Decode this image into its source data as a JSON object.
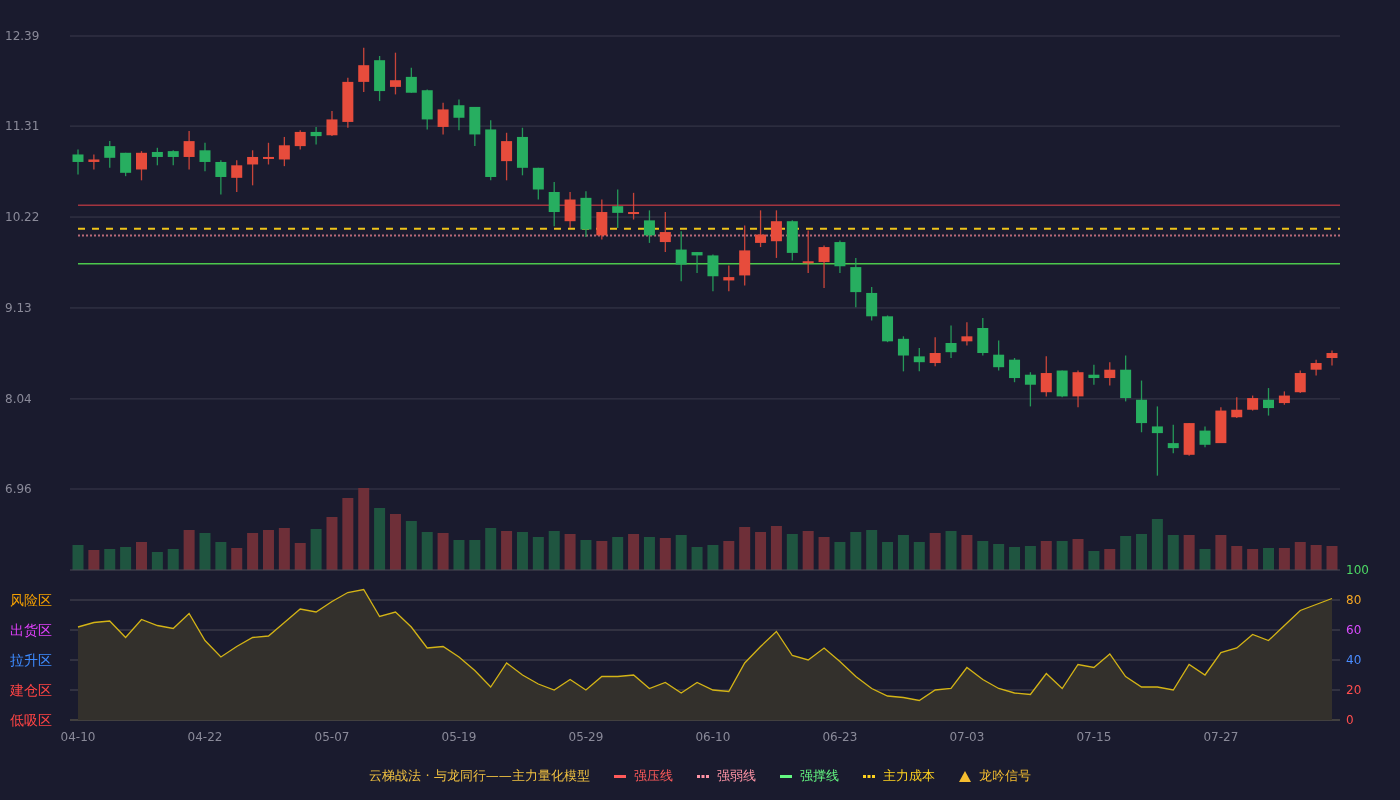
{
  "price_chart": {
    "chart_data": {
      "type": "candlestick",
      "grid": true,
      "ylim": [
        6.96,
        12.39
      ],
      "yticks": [
        12.39,
        11.31,
        10.22,
        9.13,
        8.04,
        6.96
      ],
      "categories": [
        null,
        null,
        null,
        null,
        null,
        null,
        null,
        null,
        null,
        null,
        null,
        null,
        null,
        null,
        null,
        null,
        null,
        null,
        null,
        null,
        null,
        null,
        null,
        null,
        null,
        null,
        null,
        null,
        null,
        null,
        null,
        null,
        null,
        null,
        null,
        null,
        null,
        null,
        null,
        null,
        null,
        null,
        null,
        null,
        null,
        null,
        null,
        null,
        null,
        null,
        null,
        null,
        null,
        null,
        null,
        null,
        null,
        null,
        null,
        null,
        null,
        null,
        null,
        null,
        null,
        null,
        null,
        null,
        null,
        null,
        null,
        null,
        null,
        null,
        null,
        null,
        null,
        null,
        null,
        null
      ],
      "ohlc": [
        [
          10.97,
          11.03,
          10.73,
          10.88
        ],
        [
          10.88,
          10.97,
          10.79,
          10.91
        ],
        [
          11.07,
          11.13,
          10.81,
          10.93
        ],
        [
          10.99,
          10.99,
          10.71,
          10.75
        ],
        [
          10.79,
          11.01,
          10.66,
          10.99
        ],
        [
          11.0,
          11.05,
          10.84,
          10.94
        ],
        [
          11.01,
          11.02,
          10.84,
          10.94
        ],
        [
          10.94,
          11.25,
          10.79,
          11.13
        ],
        [
          11.02,
          11.11,
          10.77,
          10.88
        ],
        [
          10.88,
          10.9,
          10.49,
          10.7
        ],
        [
          10.69,
          10.9,
          10.52,
          10.84
        ],
        [
          10.85,
          11.02,
          10.6,
          10.94
        ],
        [
          10.93,
          11.11,
          10.85,
          10.94
        ],
        [
          10.91,
          11.18,
          10.83,
          11.08
        ],
        [
          11.07,
          11.26,
          11.03,
          11.24
        ],
        [
          11.24,
          11.3,
          11.09,
          11.19
        ],
        [
          11.2,
          11.49,
          11.19,
          11.39
        ],
        [
          11.36,
          11.89,
          11.29,
          11.84
        ],
        [
          11.84,
          12.25,
          11.72,
          12.04
        ],
        [
          12.1,
          12.15,
          11.61,
          11.73
        ],
        [
          11.78,
          12.19,
          11.69,
          11.86
        ],
        [
          11.9,
          12.01,
          11.71,
          11.71
        ],
        [
          11.74,
          11.75,
          11.27,
          11.39
        ],
        [
          11.3,
          11.59,
          11.21,
          11.51
        ],
        [
          11.56,
          11.63,
          11.26,
          11.41
        ],
        [
          11.54,
          11.54,
          11.07,
          11.21
        ],
        [
          11.27,
          11.38,
          10.66,
          10.7
        ],
        [
          10.89,
          11.23,
          10.66,
          11.13
        ],
        [
          11.18,
          11.29,
          10.72,
          10.81
        ],
        [
          10.81,
          10.81,
          10.43,
          10.55
        ],
        [
          10.52,
          10.64,
          10.11,
          10.28
        ],
        [
          10.17,
          10.52,
          10.09,
          10.43
        ],
        [
          10.45,
          10.53,
          9.98,
          10.07
        ],
        [
          10.0,
          10.43,
          9.95,
          10.28
        ],
        [
          10.35,
          10.55,
          10.09,
          10.27
        ],
        [
          10.27,
          10.51,
          10.19,
          10.28
        ],
        [
          10.18,
          10.3,
          9.91,
          10.0
        ],
        [
          9.92,
          10.28,
          9.8,
          10.04
        ],
        [
          9.83,
          10.05,
          9.45,
          9.65
        ],
        [
          9.8,
          9.8,
          9.55,
          9.76
        ],
        [
          9.76,
          9.77,
          9.33,
          9.51
        ],
        [
          9.46,
          9.64,
          9.33,
          9.5
        ],
        [
          9.52,
          10.12,
          9.4,
          9.82
        ],
        [
          9.91,
          10.3,
          9.86,
          10.01
        ],
        [
          9.93,
          10.3,
          9.73,
          10.17
        ],
        [
          10.17,
          10.18,
          9.7,
          9.79
        ],
        [
          9.67,
          10.06,
          9.55,
          9.69
        ],
        [
          9.68,
          9.88,
          9.37,
          9.86
        ],
        [
          9.92,
          9.94,
          9.55,
          9.63
        ],
        [
          9.62,
          9.73,
          9.14,
          9.32
        ],
        [
          9.31,
          9.38,
          8.98,
          9.03
        ],
        [
          9.03,
          9.04,
          8.72,
          8.73
        ],
        [
          8.76,
          8.79,
          8.37,
          8.56
        ],
        [
          8.55,
          8.65,
          8.37,
          8.48
        ],
        [
          8.47,
          8.78,
          8.43,
          8.59
        ],
        [
          8.71,
          8.92,
          8.53,
          8.6
        ],
        [
          8.73,
          8.96,
          8.68,
          8.79
        ],
        [
          8.89,
          9.01,
          8.56,
          8.59
        ],
        [
          8.57,
          8.74,
          8.38,
          8.42
        ],
        [
          8.51,
          8.53,
          8.24,
          8.29
        ],
        [
          8.33,
          8.36,
          7.95,
          8.21
        ],
        [
          8.12,
          8.55,
          8.07,
          8.35
        ],
        [
          8.38,
          8.38,
          8.06,
          8.07
        ],
        [
          8.07,
          8.38,
          7.94,
          8.36
        ],
        [
          8.33,
          8.45,
          8.21,
          8.29
        ],
        [
          8.29,
          8.48,
          8.2,
          8.39
        ],
        [
          8.39,
          8.56,
          8.01,
          8.05
        ],
        [
          8.03,
          8.26,
          7.64,
          7.75
        ],
        [
          7.71,
          7.95,
          7.12,
          7.63
        ],
        [
          7.51,
          7.73,
          7.39,
          7.45
        ],
        [
          7.37,
          7.75,
          7.36,
          7.75
        ],
        [
          7.66,
          7.71,
          7.46,
          7.49
        ],
        [
          7.51,
          7.94,
          7.51,
          7.9
        ],
        [
          7.82,
          8.06,
          7.81,
          7.91
        ],
        [
          7.91,
          8.08,
          7.9,
          8.05
        ],
        [
          8.03,
          8.17,
          7.84,
          7.93
        ],
        [
          7.99,
          8.13,
          7.97,
          8.08
        ],
        [
          8.12,
          8.38,
          8.11,
          8.35
        ],
        [
          8.39,
          8.51,
          8.32,
          8.47
        ],
        [
          8.53,
          8.62,
          8.44,
          8.59
        ]
      ],
      "ref_lines": [
        {
          "axis": "y",
          "value": 10.36,
          "color": "#a3343f"
        },
        {
          "axis": "y",
          "value": 10.0,
          "color": "#b86a78"
        },
        {
          "axis": "y",
          "value": 9.66,
          "color": "#4cc94c"
        },
        {
          "axis": "y",
          "value": 10.08,
          "color": "#f0c419"
        }
      ]
    }
  },
  "indicator_chart": {
    "chart_data": {
      "type": "area",
      "grid": true,
      "ylim": [
        0,
        100
      ],
      "categories": [
        "04-10",
        null,
        null,
        null,
        null,
        null,
        null,
        null,
        "04-22",
        null,
        null,
        null,
        null,
        null,
        null,
        null,
        "05-07",
        null,
        null,
        null,
        null,
        null,
        null,
        null,
        "05-19",
        null,
        null,
        null,
        null,
        null,
        null,
        null,
        "05-29",
        null,
        null,
        null,
        null,
        null,
        null,
        null,
        "06-10",
        null,
        null,
        null,
        null,
        null,
        null,
        null,
        "06-23",
        null,
        null,
        null,
        null,
        null,
        null,
        null,
        "07-03",
        null,
        null,
        null,
        null,
        null,
        null,
        null,
        "07-15",
        null,
        null,
        null,
        null,
        null,
        null,
        null,
        "07-27",
        null,
        null,
        null,
        null,
        null,
        null,
        null
      ],
      "yticks": [
        100,
        80,
        60,
        40,
        20,
        0
      ],
      "series": [
        {
          "color": "#d4b416",
          "values": [
            62,
            65,
            66,
            55,
            67,
            63,
            61,
            71,
            53,
            42,
            49,
            55,
            56,
            65,
            74,
            72,
            79,
            85,
            87,
            69,
            72,
            62,
            48,
            49,
            42,
            33,
            22,
            38,
            30,
            24,
            20,
            27,
            20,
            29,
            29,
            30,
            21,
            25,
            18,
            25,
            20,
            19,
            38,
            49,
            59,
            43,
            40,
            48,
            39,
            29,
            21,
            16,
            15,
            13,
            20,
            21,
            35,
            27,
            21,
            18,
            17,
            31,
            21,
            37,
            35,
            44,
            29,
            22,
            22,
            20,
            37,
            30,
            45,
            48,
            57,
            53,
            63,
            73,
            77,
            81
          ]
        }
      ]
    },
    "zone_labels": [
      {
        "label": "风险区",
        "color": "#f5a000"
      },
      {
        "label": "出货区",
        "color": "#e040fb"
      },
      {
        "label": "拉升区",
        "color": "#3d8bff"
      },
      {
        "label": "建仓区",
        "color": "#ff4444"
      },
      {
        "label": "低吸区",
        "color": "#ff4444"
      }
    ]
  },
  "legend": {
    "title": "云梯战法 · 与龙同行——主力量化模型",
    "items": [
      {
        "label": "强压线",
        "kind": "line",
        "color": "#ff5a5a"
      },
      {
        "label": "强弱线",
        "kind": "dashed",
        "color": "#ff94a6"
      },
      {
        "label": "强撑线",
        "kind": "line",
        "color": "#64f882"
      },
      {
        "label": "主力成本",
        "kind": "dashed",
        "color": "#ffd21f"
      },
      {
        "label": "龙吟信号",
        "kind": "triangle",
        "color": "#f5bd30"
      }
    ]
  }
}
